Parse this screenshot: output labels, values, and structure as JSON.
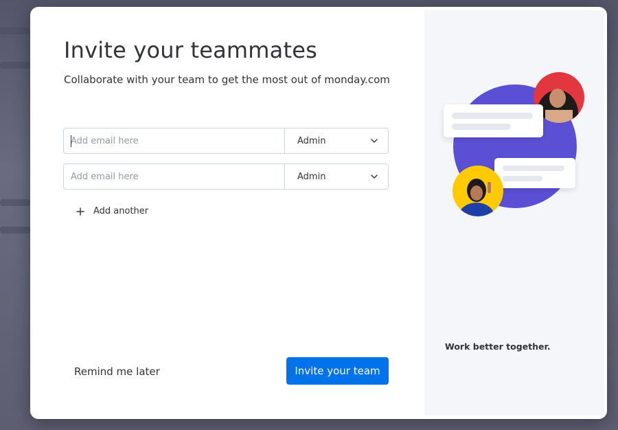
{
  "modal": {
    "title": "Invite your teammates",
    "subtitle": "Collaborate with your team to get the most out of monday.com"
  },
  "invites": [
    {
      "email_value": "",
      "email_placeholder": "Add email here",
      "role": "Admin"
    },
    {
      "email_value": "",
      "email_placeholder": "Add email here",
      "role": "Admin"
    }
  ],
  "add_another": {
    "icon": "plus-icon",
    "label": "Add another"
  },
  "footer": {
    "remind_label": "Remind me later",
    "invite_label": "Invite your team"
  },
  "side_panel": {
    "tagline": "Work better together."
  },
  "colors": {
    "primary": "#0073ea",
    "text": "#323338",
    "placeholder": "#9699a6",
    "border": "#d0d4e4",
    "side_bg": "#f5f6fa",
    "circle_purple": "#5b4fd6",
    "avatar_red": "#e2373f",
    "avatar_yellow": "#ffcb00"
  }
}
